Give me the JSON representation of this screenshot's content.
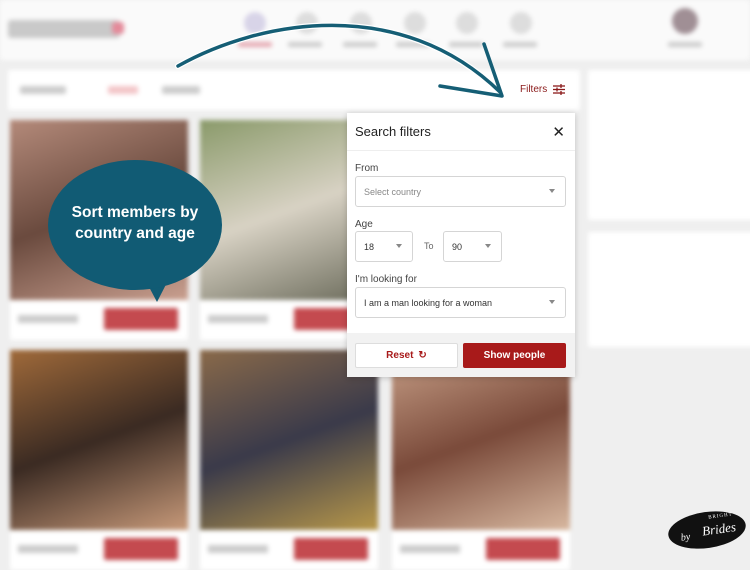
{
  "header": {
    "filters_label": "Filters",
    "filters_icon": "sliders-icon"
  },
  "popup": {
    "title": "Search filters",
    "close_icon": "close-icon",
    "from_label": "From",
    "country_placeholder": "Select country",
    "age_label": "Age",
    "age_from": "18",
    "age_to_label": "To",
    "age_to": "90",
    "looking_label": "I'm looking for",
    "looking_value": "I am a man looking for a woman",
    "reset_label": "Reset",
    "reset_icon": "refresh-icon",
    "show_label": "Show people"
  },
  "annotation": {
    "text_line1": "Sort members by",
    "text_line2": "country and age",
    "arrow_color": "#155e75",
    "bubble_color": "#115b74"
  },
  "watermark": {
    "by": "by",
    "brand": "Brides",
    "tag": "BRIGHT"
  },
  "colors": {
    "accent": "#a81a1a",
    "filters": "#8b1a1a"
  }
}
